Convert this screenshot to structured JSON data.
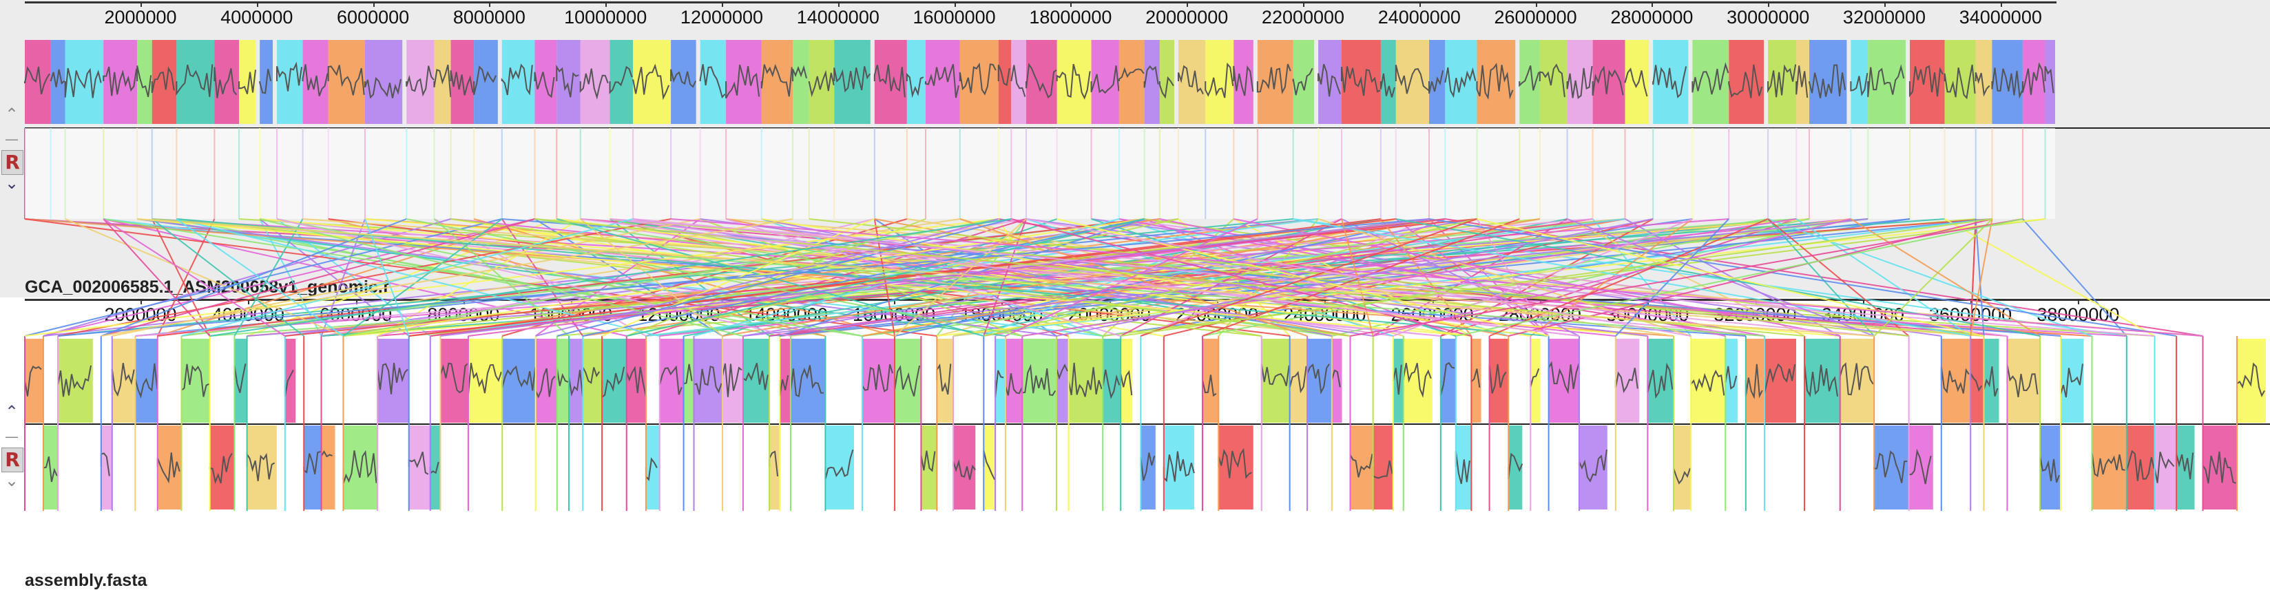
{
  "genomes": [
    {
      "name": "GCA_002006585.1_ASM200658v1_genomic.f",
      "ruler_ticks": [
        "2000000",
        "4000000",
        "6000000",
        "8000000",
        "10000000",
        "12000000",
        "14000000",
        "16000000",
        "18000000",
        "20000000",
        "22000000",
        "24000000",
        "26000000",
        "28000000",
        "30000000",
        "32000000",
        "34000000"
      ]
    },
    {
      "name": "assembly.fasta",
      "ruler_ticks": [
        "2000000",
        "4000000",
        "6000000",
        "8000000",
        "10000000",
        "12000000",
        "14000000",
        "16000000",
        "18000000",
        "20000000",
        "22000000",
        "24000000",
        "26000000",
        "28000000",
        "30000000",
        "32000000",
        "34000000",
        "36000000",
        "38000000"
      ]
    }
  ],
  "controls": {
    "scroll_up": "⌃",
    "minus": "—",
    "reference": "R",
    "scroll_down": "⌄"
  },
  "colors": {
    "blocks": [
      "#e84a9c",
      "#f8f852",
      "#5b8ef0",
      "#63e3f2",
      "#e563d8",
      "#f79a50",
      "#8fe673",
      "#b07bf0",
      "#ef4c4c",
      "#b8e24a",
      "#e9a0e6",
      "#3cc7b0",
      "#f0d070"
    ],
    "block_line": "#555555",
    "ruler": "#333333"
  }
}
